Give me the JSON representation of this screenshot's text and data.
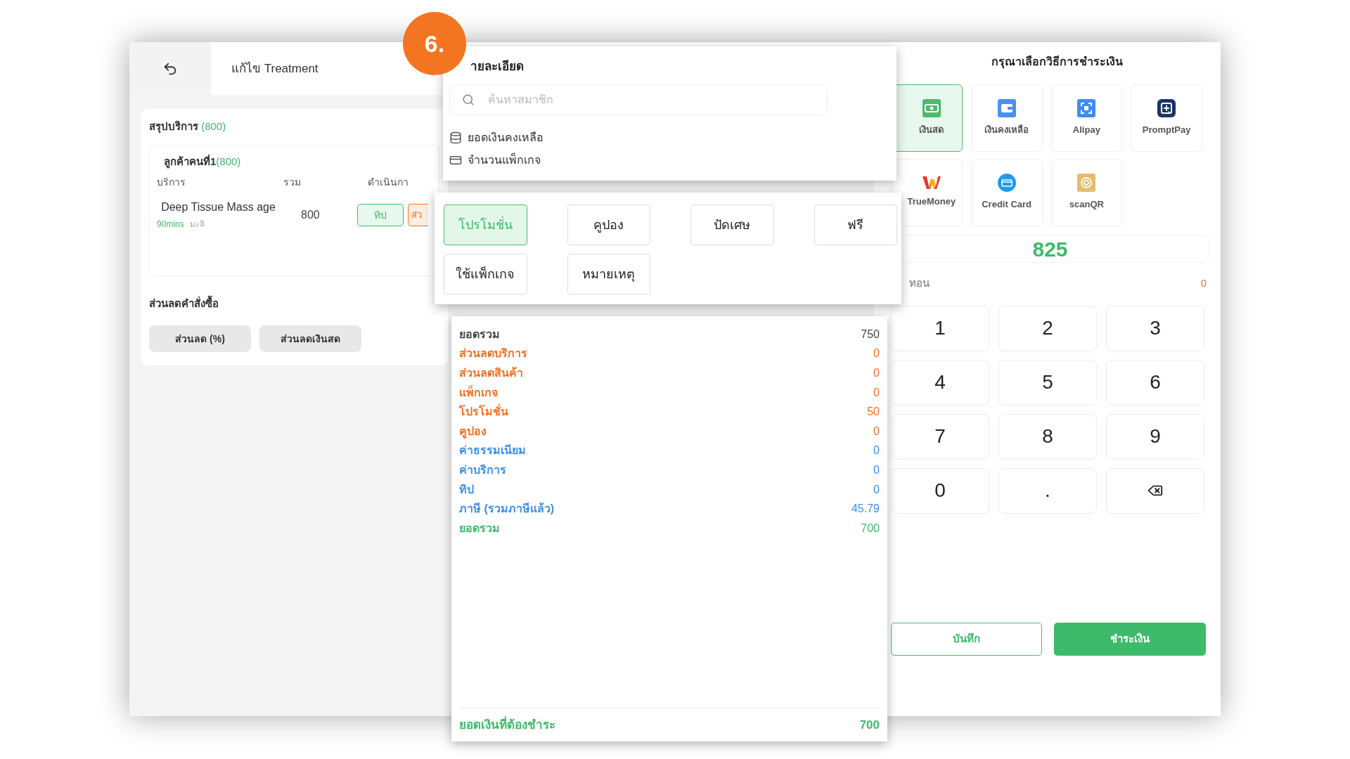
{
  "step_badge": "6.",
  "header": {
    "title": "แก้ไข Treatment"
  },
  "service_summary": {
    "title": "สรุปบริการ",
    "total": "(800)",
    "customer": {
      "title": "ลูกค้าคนที่1",
      "total": "(800)"
    },
    "columns": [
      "บริการ",
      "รวม",
      "ดำเนินกา"
    ],
    "rows": [
      {
        "service": "Deep Tissue Mass age",
        "duration": "90mins",
        "staff": "มะลิ",
        "total": "800",
        "actions": [
          "ทิป",
          "ส่ว"
        ]
      }
    ]
  },
  "order_discount": {
    "title": "ส่วนลดคำสั่งซื้อ",
    "buttons": [
      "ส่วนลด (%)",
      "ส่วนลดเงินสด"
    ]
  },
  "detail_panel": {
    "title": "ายละเอียด",
    "search": {
      "placeholder": "ค้นหาสมาชิก"
    },
    "info": [
      {
        "kind": "balance",
        "label": "ยอดเงินคงเหลือ"
      },
      {
        "kind": "package",
        "label": "จำนวนแพ็กเกจ"
      }
    ]
  },
  "option_buttons": [
    {
      "label": "โปรโมชั่น",
      "selected": true
    },
    {
      "label": "คูปอง",
      "selected": false
    },
    {
      "label": "ปัดเศษ",
      "selected": false
    },
    {
      "label": "ฟรี",
      "selected": false
    },
    {
      "label": "ใช้แพ็กเกจ",
      "selected": false
    },
    {
      "label": "หมายเหตุ",
      "selected": false
    }
  ],
  "summary": {
    "rows": [
      {
        "label": "ยอดรวม",
        "value": "750",
        "color": "#444444"
      },
      {
        "label": "ส่วนลดบริการ",
        "value": "0",
        "color": "#f36f21"
      },
      {
        "label": "ส่วนลดสินค้า",
        "value": "0",
        "color": "#f36f21"
      },
      {
        "label": "แพ็กเกจ",
        "value": "0",
        "color": "#f36f21"
      },
      {
        "label": "โปรโมชั่น",
        "value": "50",
        "color": "#f36f21"
      },
      {
        "label": "คูปอง",
        "value": "0",
        "color": "#f36f21"
      },
      {
        "label": "ค่าธรรมเนียม",
        "value": "0",
        "color": "#3b8fe8"
      },
      {
        "label": "ค่าบริการ",
        "value": "0",
        "color": "#3b8fe8"
      },
      {
        "label": "ทิป",
        "value": "0",
        "color": "#3b8fe8"
      },
      {
        "label": "ภาษี (รวมภาษีแล้ว)",
        "value": "45.79",
        "color": "#3b8fe8"
      },
      {
        "label": "ยอดรวม",
        "value": "700",
        "color": "#3dba6a"
      }
    ],
    "due": {
      "label": "ยอดเงินที่ต้องชำระ",
      "value": "700"
    }
  },
  "payment": {
    "title": "กรุณาเลือกวิธีการชำระเงิน",
    "methods": [
      {
        "kind": "cash",
        "label": "เงินสด",
        "selected": true
      },
      {
        "kind": "wallet",
        "label": "เงินคงเหลือ",
        "selected": false
      },
      {
        "kind": "alipay",
        "label": "Alipay",
        "selected": false
      },
      {
        "kind": "promptpay",
        "label": "PromptPay",
        "selected": false
      },
      {
        "kind": "truemoney",
        "label": "TrueMoney",
        "selected": false
      },
      {
        "kind": "card",
        "label": "Credit Card",
        "selected": false
      },
      {
        "kind": "qr",
        "label": "scanQR",
        "selected": false
      }
    ],
    "amount": "825",
    "change": {
      "label": "ทอน",
      "value": "0"
    },
    "keys": [
      {
        "kind": "digit",
        "label": "1"
      },
      {
        "kind": "digit",
        "label": "2"
      },
      {
        "kind": "digit",
        "label": "3"
      },
      {
        "kind": "digit",
        "label": "4"
      },
      {
        "kind": "digit",
        "label": "5"
      },
      {
        "kind": "digit",
        "label": "6"
      },
      {
        "kind": "digit",
        "label": "7"
      },
      {
        "kind": "digit",
        "label": "8"
      },
      {
        "kind": "digit",
        "label": "9"
      },
      {
        "kind": "digit",
        "label": "0"
      },
      {
        "kind": "digit",
        "label": "."
      },
      {
        "kind": "backspace"
      }
    ],
    "buttons": {
      "save": "บันทึก",
      "pay": "ชำระเงิน"
    }
  }
}
